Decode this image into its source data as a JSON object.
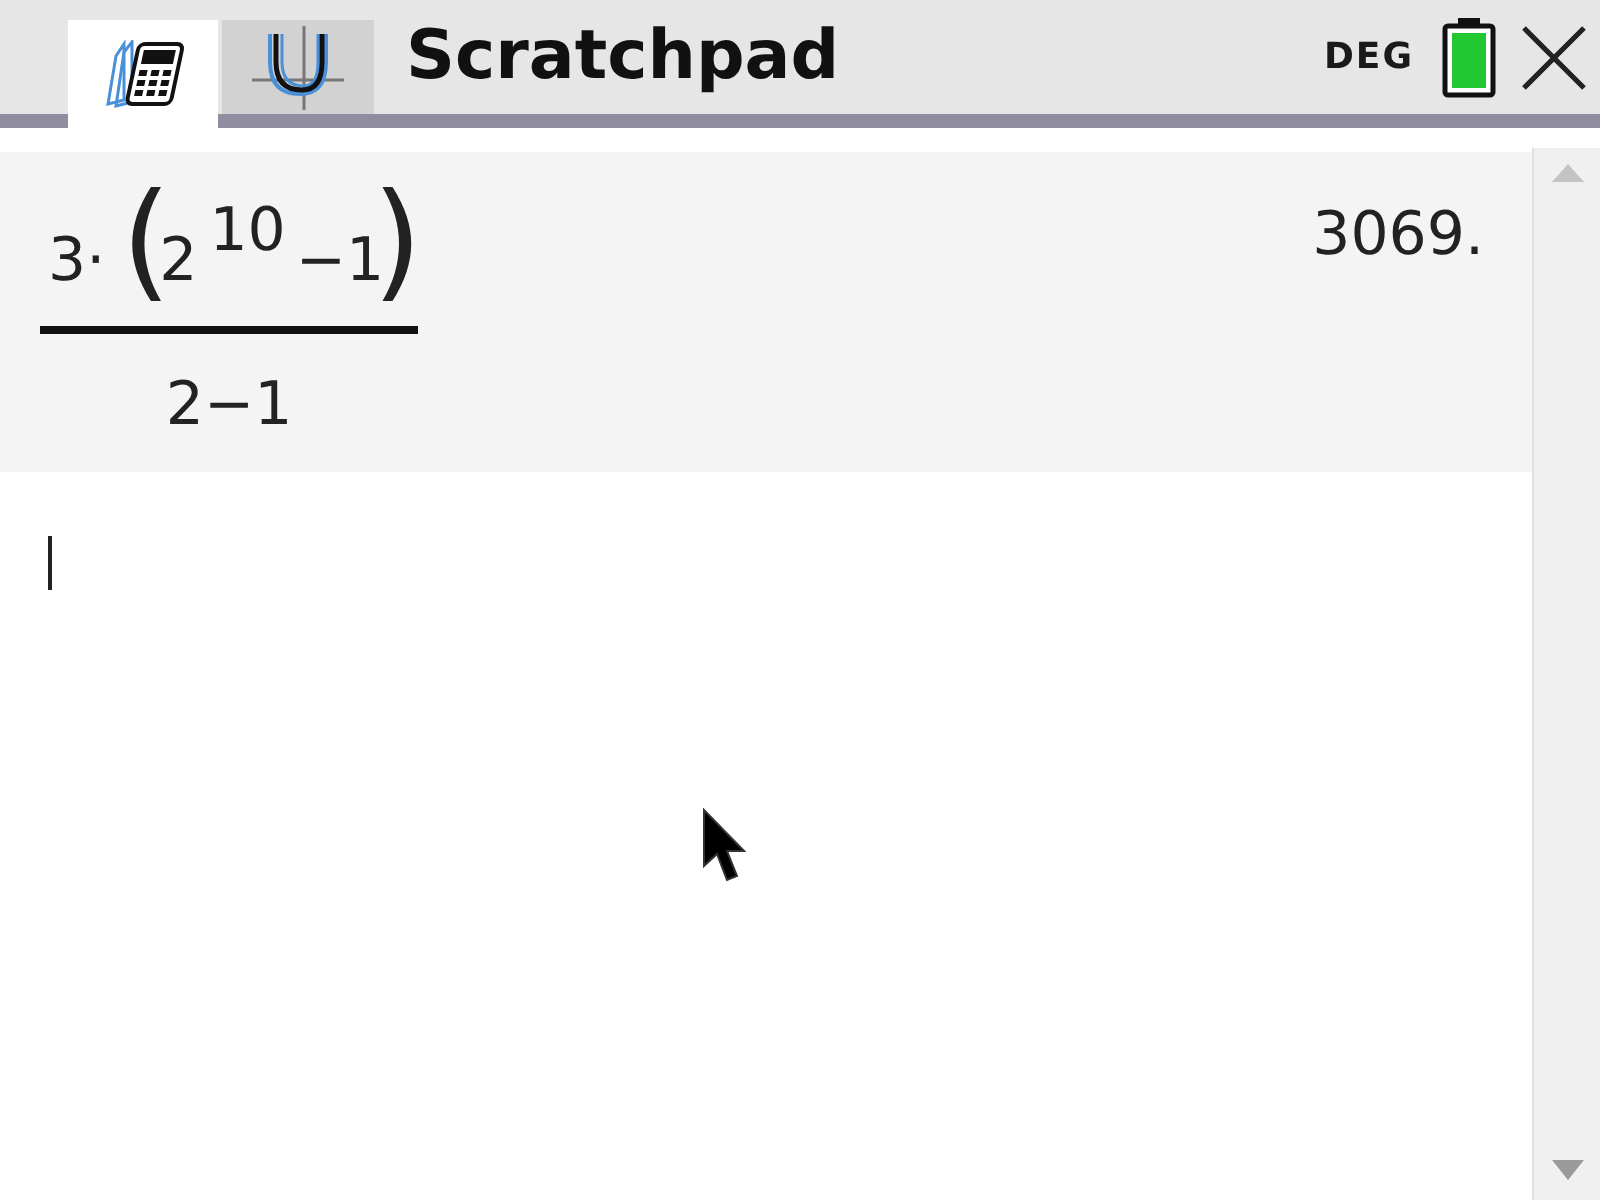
{
  "tabs": [
    {
      "kind": "calculator",
      "selected": true
    },
    {
      "kind": "graph",
      "selected": false
    }
  ],
  "title": "Scratchpad",
  "status": {
    "angle_mode": "DEG"
  },
  "history": [
    {
      "numerator": {
        "factor": "3·",
        "open_paren": "(",
        "base": "2",
        "exponent": "10",
        "rest": "−1",
        "close_paren": ")"
      },
      "denominator": "2−1",
      "result": "3069."
    }
  ]
}
